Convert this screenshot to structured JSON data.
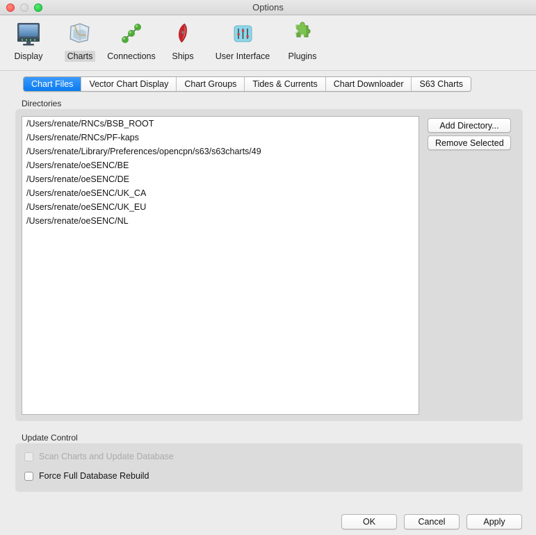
{
  "window": {
    "title": "Options",
    "controls": [
      {
        "name": "close",
        "color": "#f9564f"
      },
      {
        "name": "minimize",
        "color": "#d2d2d2"
      },
      {
        "name": "zoom",
        "color": "#17c83c"
      }
    ]
  },
  "toolbar": {
    "items": [
      {
        "label": "Display",
        "icon": "monitor-icon",
        "selected": false
      },
      {
        "label": "Charts",
        "icon": "charts-icon",
        "selected": true
      },
      {
        "label": "Connections",
        "icon": "connections-icon",
        "selected": false
      },
      {
        "label": "Ships",
        "icon": "ship-icon",
        "selected": false
      },
      {
        "label": "User Interface",
        "icon": "sliders-icon",
        "selected": false
      },
      {
        "label": "Plugins",
        "icon": "puzzle-piece-icon",
        "selected": false
      }
    ]
  },
  "tabs": [
    {
      "label": "Chart Files",
      "active": true
    },
    {
      "label": "Vector Chart Display",
      "active": false
    },
    {
      "label": "Chart Groups",
      "active": false
    },
    {
      "label": "Tides & Currents",
      "active": false
    },
    {
      "label": "Chart Downloader",
      "active": false
    },
    {
      "label": "S63 Charts",
      "active": false
    }
  ],
  "directories": {
    "group_label": "Directories",
    "entries": [
      "/Users/renate/RNCs/BSB_ROOT",
      "/Users/renate/RNCs/PF-kaps",
      "/Users/renate/Library/Preferences/opencpn/s63/s63charts/49",
      "/Users/renate/oeSENC/BE",
      "/Users/renate/oeSENC/DE",
      "/Users/renate/oeSENC/UK_CA",
      "/Users/renate/oeSENC/UK_EU",
      "/Users/renate/oeSENC/NL"
    ],
    "add_button": "Add Directory...",
    "remove_button": "Remove Selected"
  },
  "update_control": {
    "group_label": "Update Control",
    "scan": {
      "label": "Scan Charts and Update Database",
      "checked": false,
      "enabled": false
    },
    "force": {
      "label": "Force Full Database Rebuild",
      "checked": false,
      "enabled": true
    }
  },
  "footer": {
    "ok": "OK",
    "cancel": "Cancel",
    "apply": "Apply"
  },
  "colors": {
    "accent": "#0a7bf0",
    "window_bg": "#ececec",
    "group_bg": "#dcdcdc",
    "list_bg": "#ffffff"
  }
}
